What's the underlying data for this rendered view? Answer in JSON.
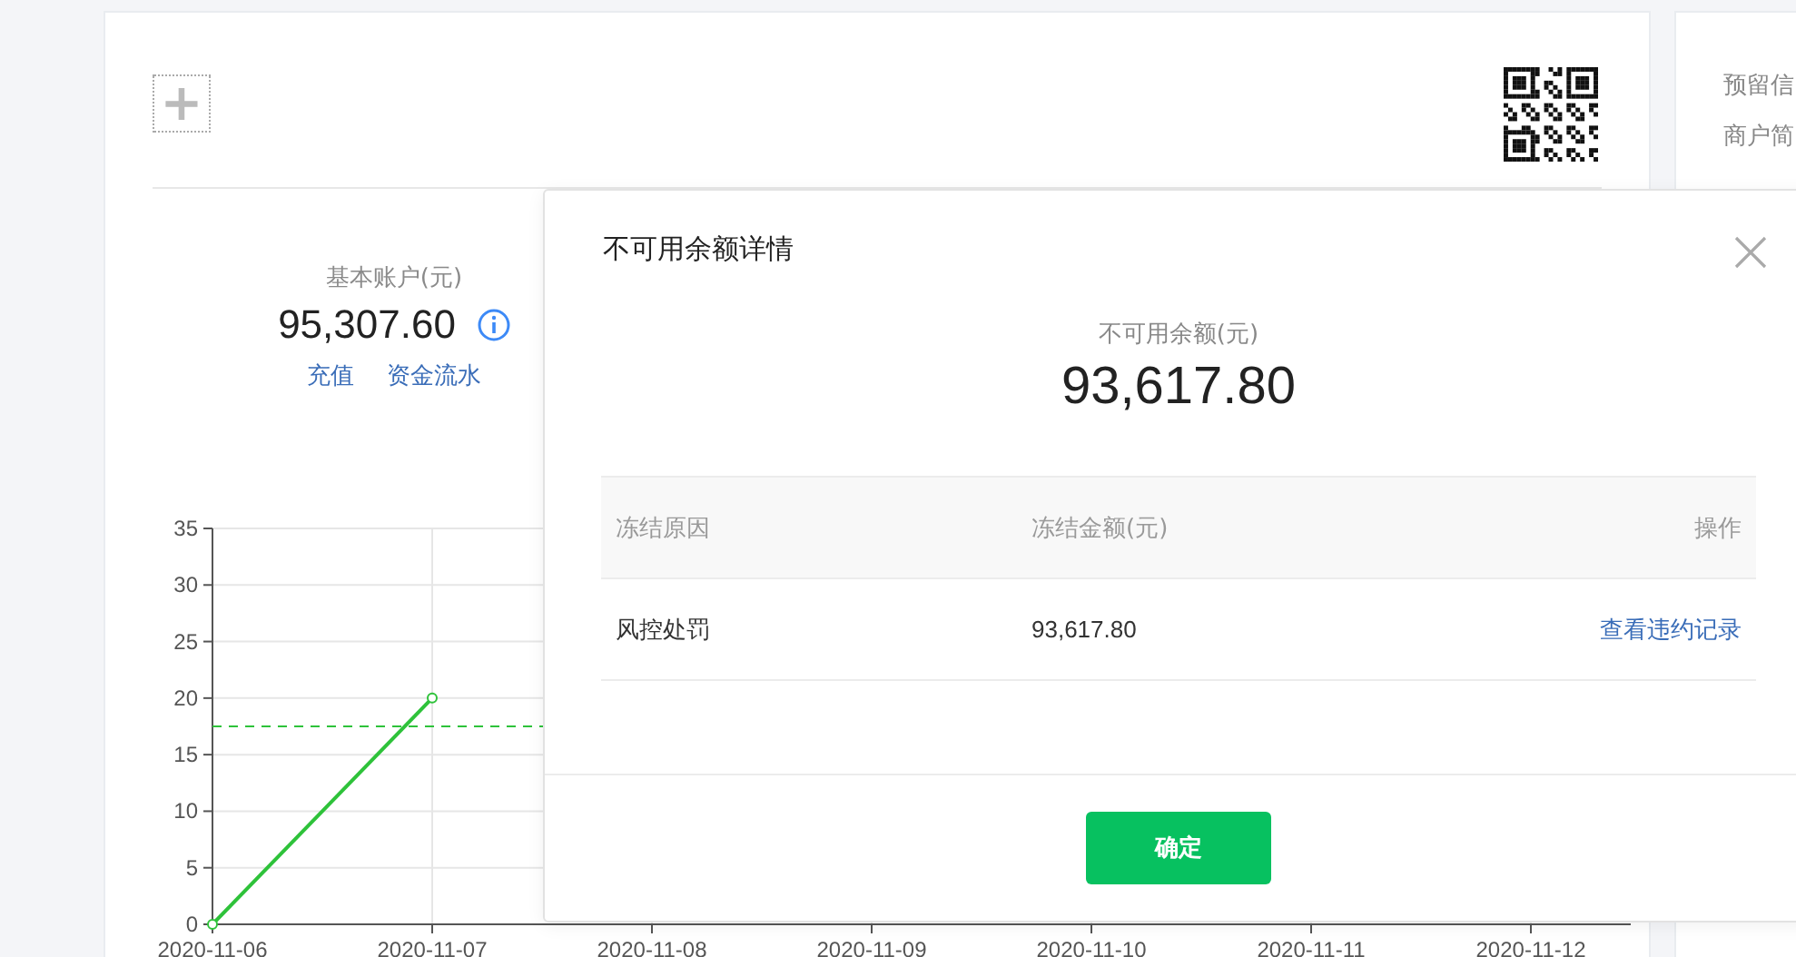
{
  "header": {
    "add_button": "+"
  },
  "account": {
    "label": "基本账户(元)",
    "amount": "95,307.60",
    "links": [
      "充值",
      "资金流水"
    ]
  },
  "chart_data": {
    "type": "line",
    "categories": [
      "2020-11-06",
      "2020-11-07",
      "2020-11-08",
      "2020-11-09",
      "2020-11-10",
      "2020-11-11",
      "2020-11-12"
    ],
    "yticks": [
      0,
      5,
      10,
      15,
      20,
      25,
      30,
      35
    ],
    "ylim": [
      0,
      35
    ],
    "grid": true,
    "series": [
      {
        "color": "#2ec23a",
        "marker": "circle",
        "values": [
          0,
          20,
          null,
          null,
          null,
          null,
          null
        ]
      }
    ],
    "ref_lines": [
      {
        "axis": "y",
        "value": 17.5,
        "color": "#2ec23a"
      }
    ]
  },
  "side_panel": {
    "items": [
      "预留信",
      "商户简"
    ]
  },
  "dialog": {
    "title": "不可用余额详情",
    "summary_label": "不可用余额(元)",
    "summary_amount": "93,617.80",
    "table": {
      "columns": [
        "冻结原因",
        "冻结金额(元)",
        "操作"
      ],
      "rows": [
        {
          "reason": "风控处罚",
          "amount": "93,617.80",
          "action": "查看违约记录"
        }
      ]
    },
    "confirm_button": "确定"
  }
}
